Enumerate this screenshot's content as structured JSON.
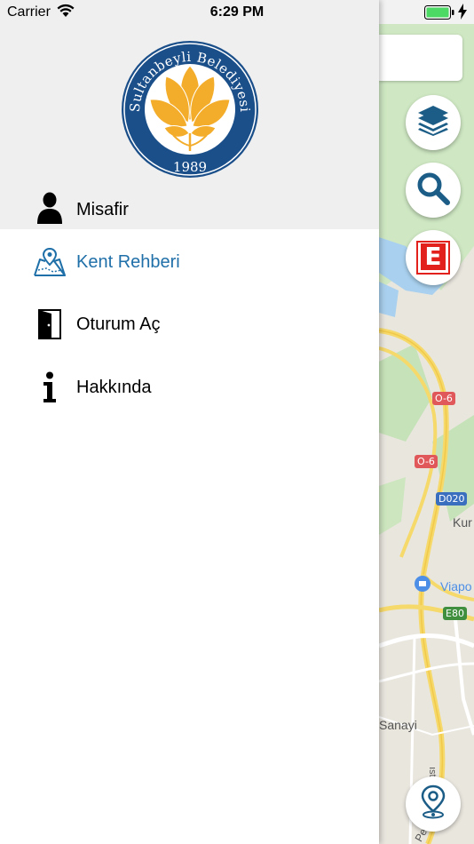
{
  "status_bar": {
    "carrier": "Carrier",
    "time": "6:29 PM"
  },
  "logo": {
    "text_top": "Sultanbeyli Belediyesi",
    "year": "1989",
    "colors": {
      "ring": "#1b4f8a",
      "petals": "#f3ad2b"
    }
  },
  "drawer": {
    "user_name": "Misafir",
    "menu": [
      {
        "label": "Kent Rehberi",
        "icon": "city-map-icon",
        "active": true
      },
      {
        "label": "Oturum Aç",
        "icon": "door-icon",
        "active": false
      },
      {
        "label": "Hakkında",
        "icon": "info-icon",
        "active": false
      }
    ],
    "active_color": "#1f6fa8"
  },
  "map": {
    "road_labels": [
      "O-6",
      "O-6",
      "D020",
      "E80"
    ],
    "place_labels": [
      "Kur",
      "Viapo",
      "Sanayi"
    ],
    "pharmacy_letter": "E",
    "road_vertical_text": "ıstı",
    "road_bottom_text": "Pe"
  }
}
